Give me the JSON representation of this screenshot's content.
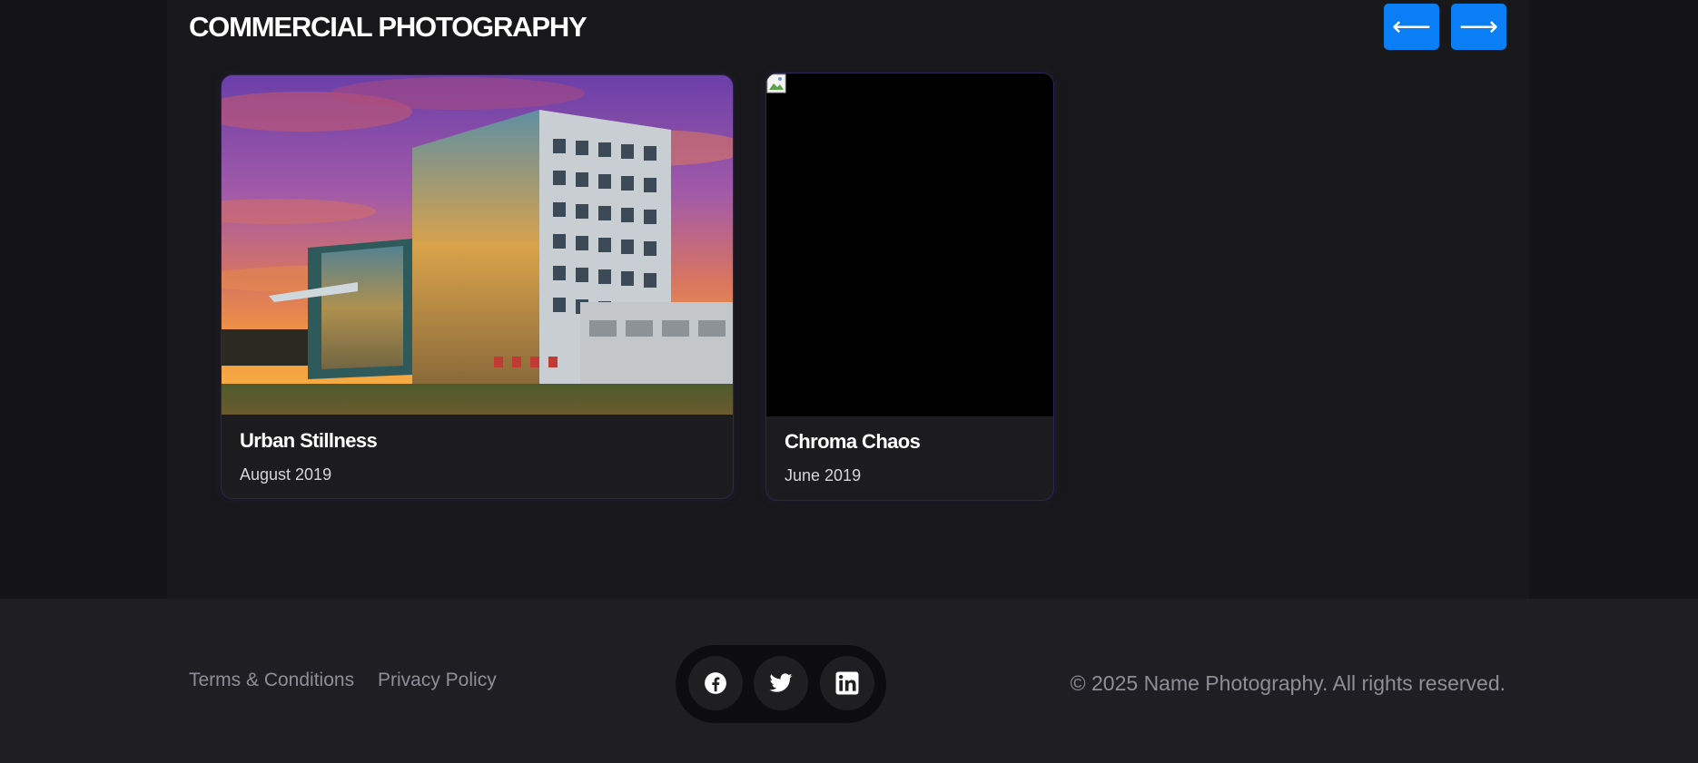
{
  "section": {
    "title": "COMMERCIAL PHOTOGRAPHY",
    "prev_label": "⟵",
    "next_label": "⟶"
  },
  "cards": [
    {
      "title": "Urban Stillness",
      "date": "August 2019",
      "image": "hotel-building-at-sunset-photo"
    },
    {
      "title": "Chroma Chaos",
      "date": "June 2019",
      "image": "broken-image-placeholder"
    }
  ],
  "footer": {
    "links": [
      "Terms & Conditions",
      "Privacy Policy"
    ],
    "social": [
      "facebook-icon",
      "twitter-icon",
      "linkedin-icon"
    ],
    "copyright": "© 2025 Name Photography. All rights reserved."
  },
  "colors": {
    "accent": "#0a7ff5",
    "background": "#141417",
    "panel": "#18181b",
    "card": "#1c1c1e",
    "footer": "#1f1f23",
    "muted_text": "#8e8e96"
  }
}
